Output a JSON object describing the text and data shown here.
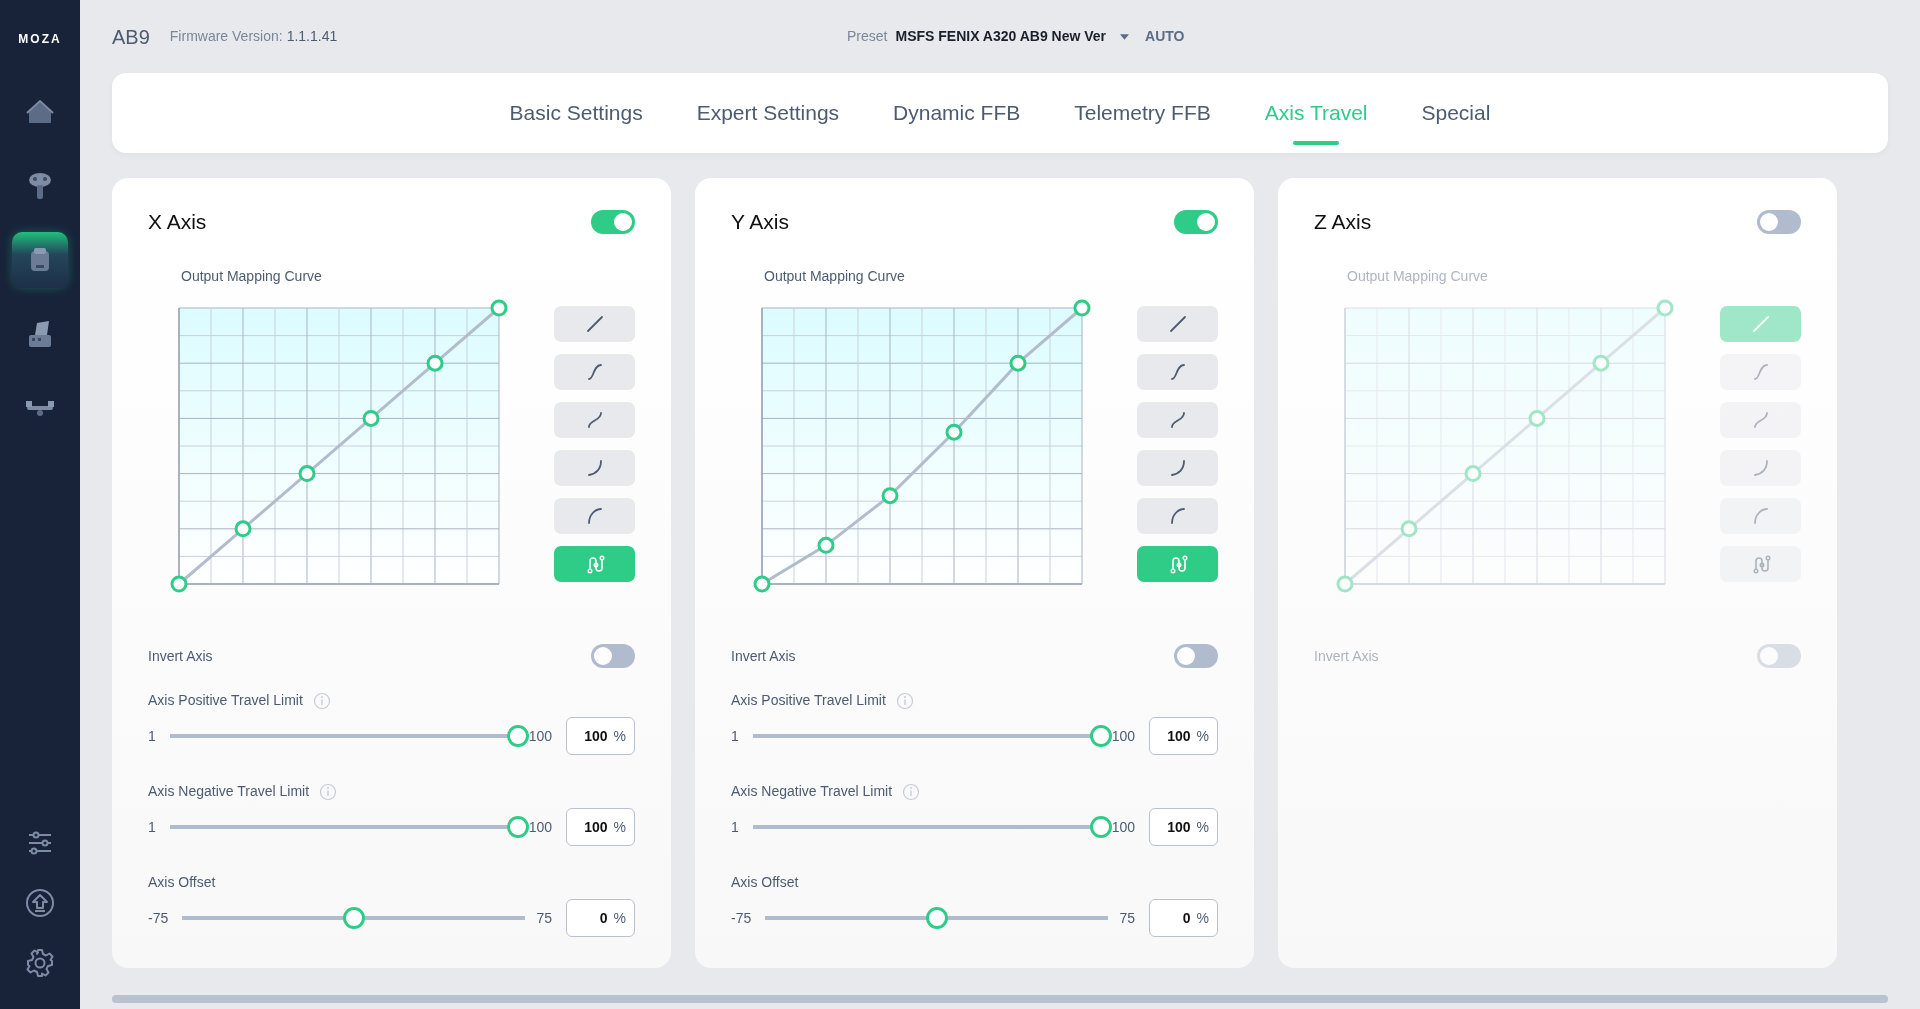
{
  "sidebar": {
    "logo": "MOZA",
    "items": [
      {
        "kind": "home",
        "selected": false
      },
      {
        "kind": "joystick",
        "selected": false
      },
      {
        "kind": "base",
        "selected": true
      },
      {
        "kind": "throttle",
        "selected": false
      },
      {
        "kind": "pedals",
        "selected": false
      }
    ],
    "bottom_items": [
      {
        "kind": "sliders"
      },
      {
        "kind": "upload"
      },
      {
        "kind": "settings"
      }
    ]
  },
  "header": {
    "device": "AB9",
    "firmware_label": "Firmware Version:",
    "firmware_version": "1.1.1.41",
    "preset_label": "Preset",
    "preset": "MSFS FENIX A320 AB9 New Ver",
    "mode": "AUTO"
  },
  "tabs": [
    {
      "label": "Basic Settings",
      "selected": false
    },
    {
      "label": "Expert Settings",
      "selected": false
    },
    {
      "label": "Dynamic FFB",
      "selected": false
    },
    {
      "label": "Telemetry FFB",
      "selected": false
    },
    {
      "label": "Axis Travel",
      "selected": true
    },
    {
      "label": "Special",
      "selected": false
    }
  ],
  "axes": [
    {
      "title": "X Axis",
      "on": true,
      "curve_title": "Output Mapping Curve",
      "kind": "straight",
      "presets": [
        {
          "kind": "linear",
          "selected": false
        },
        {
          "kind": "s-curve",
          "selected": false
        },
        {
          "kind": "soft-s",
          "selected": false
        },
        {
          "kind": "exponential",
          "selected": false
        },
        {
          "kind": "logarithmic",
          "selected": false
        },
        {
          "kind": "custom",
          "selected": true
        }
      ],
      "invert": {
        "label": "Invert Axis",
        "on": false
      },
      "sliders": [
        {
          "label": "Axis Positive Travel Limit",
          "info": true,
          "min": "1",
          "max": "100",
          "level": 1,
          "value": "100",
          "unit": "%"
        },
        {
          "label": "Axis Negative Travel Limit",
          "info": true,
          "min": "1",
          "max": "100",
          "level": 1,
          "value": "100",
          "unit": "%"
        },
        {
          "label": "Axis Offset",
          "info": false,
          "min": "-75",
          "max": "75",
          "level": 0.5,
          "value": "0",
          "unit": "%"
        }
      ]
    },
    {
      "title": "Y Axis",
      "on": true,
      "curve_title": "Output Mapping Curve",
      "kind": "bent",
      "presets": [
        {
          "kind": "linear",
          "selected": false
        },
        {
          "kind": "s-curve",
          "selected": false
        },
        {
          "kind": "soft-s",
          "selected": false
        },
        {
          "kind": "exponential",
          "selected": false
        },
        {
          "kind": "logarithmic",
          "selected": false
        },
        {
          "kind": "custom",
          "selected": true
        }
      ],
      "invert": {
        "label": "Invert Axis",
        "on": false
      },
      "sliders": [
        {
          "label": "Axis Positive Travel Limit",
          "info": true,
          "min": "1",
          "max": "100",
          "level": 1,
          "value": "100",
          "unit": "%"
        },
        {
          "label": "Axis Negative Travel Limit",
          "info": true,
          "min": "1",
          "max": "100",
          "level": 1,
          "value": "100",
          "unit": "%"
        },
        {
          "label": "Axis Offset",
          "info": false,
          "min": "-75",
          "max": "75",
          "level": 0.5,
          "value": "0",
          "unit": "%"
        }
      ]
    },
    {
      "title": "Z Axis",
      "on": false,
      "curve_title": "Output Mapping Curve",
      "kind": "straight",
      "presets": [
        {
          "kind": "linear",
          "selected": true
        },
        {
          "kind": "s-curve",
          "selected": false
        },
        {
          "kind": "soft-s",
          "selected": false
        },
        {
          "kind": "exponential",
          "selected": false
        },
        {
          "kind": "logarithmic",
          "selected": false
        },
        {
          "kind": "custom",
          "selected": false
        }
      ],
      "invert": {
        "label": "Invert Axis",
        "on": false
      }
    }
  ]
}
